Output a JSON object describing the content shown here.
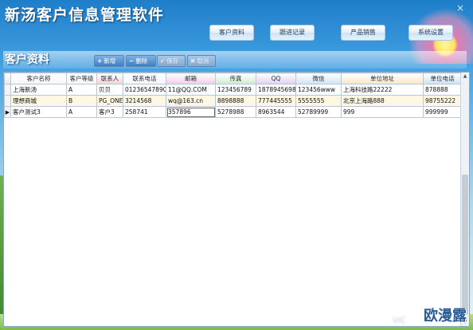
{
  "app": {
    "title": "新汤客户信息管理软件",
    "close_glyph": "×"
  },
  "nav": {
    "items": [
      {
        "label": "客户资料"
      },
      {
        "label": "跟进记录"
      },
      {
        "label": "产品销售"
      },
      {
        "label": "系统设置"
      }
    ]
  },
  "section": {
    "title": "客户资料"
  },
  "toolbar": {
    "add": {
      "icon": "+",
      "label": "新增"
    },
    "delete": {
      "icon": "−",
      "label": "删除"
    },
    "save": {
      "icon": "✔",
      "label": "保存"
    },
    "cancel": {
      "icon": "✖",
      "label": "取消"
    }
  },
  "grid": {
    "columns": [
      "客户名称",
      "客户等级",
      "联系人",
      "联系电话",
      "邮箱",
      "传真",
      "QQ",
      "微信",
      "单位地址",
      "单位电话"
    ],
    "header_colors": [
      "#f3f6f9",
      "#f3f6f9",
      "#f7d3d3",
      "#f3f6f9",
      "#f2cde8",
      "#cfeccc",
      "#ddd2f3",
      "#cfe4f5",
      "#f7e7c6",
      "#cfe0f5"
    ],
    "rows": [
      [
        "上海新汤",
        "A",
        "贝贝",
        "01236547890",
        "11@QQ.COM",
        "123456789",
        "1878945698",
        "123456www",
        "上海科技路22222",
        "878888"
      ],
      [
        "理想商城",
        "B",
        "PG_ONE",
        "3214568",
        "wq@163.cn",
        "8898888",
        "777445555",
        "5555555",
        "北京上海路888",
        "98755222"
      ],
      [
        "客户测试3",
        "A",
        "客户3",
        "258741",
        "357896",
        "5278988",
        "8963544",
        "52789999",
        "999",
        "999999"
      ]
    ],
    "current_row_marker": "▶"
  },
  "watermark": {
    "text": "欧漫露",
    "sub": "UC"
  }
}
